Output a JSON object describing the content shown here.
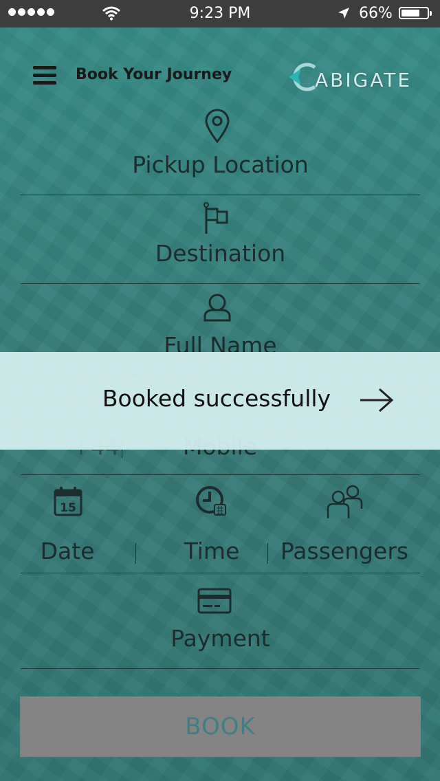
{
  "status_bar": {
    "time": "9:23 PM",
    "battery_percent": "66%",
    "battery_level": 0.66,
    "signal_dots": 5,
    "icons": [
      "signal-dots-icon",
      "wifi-icon",
      "location-arrow-icon",
      "battery-icon"
    ]
  },
  "header": {
    "title": "Book Your Journey",
    "logo_text": "ABIGATE",
    "menu_icon": "hamburger-menu-icon"
  },
  "form": {
    "pickup_label": "Pickup Location",
    "destination_label": "Destination",
    "full_name_label": "Full Name",
    "phone_prefix": "+44",
    "mobile_label": "Mobile",
    "date_label": "Date",
    "time_label": "Time",
    "passengers_label": "Passengers",
    "payment_label": "Payment",
    "calendar_day": "15"
  },
  "book_button": {
    "label": "BOOK"
  },
  "toast": {
    "message": "Booked successfully",
    "icon": "arrow-right-icon"
  },
  "colors": {
    "status_bar": "#3d3d3d",
    "background": "#3a7c79",
    "text": "#1d2c2c",
    "button_bg": "#848484",
    "button_text": "#3f7f83",
    "toast_bg": "#d6f0f0"
  }
}
